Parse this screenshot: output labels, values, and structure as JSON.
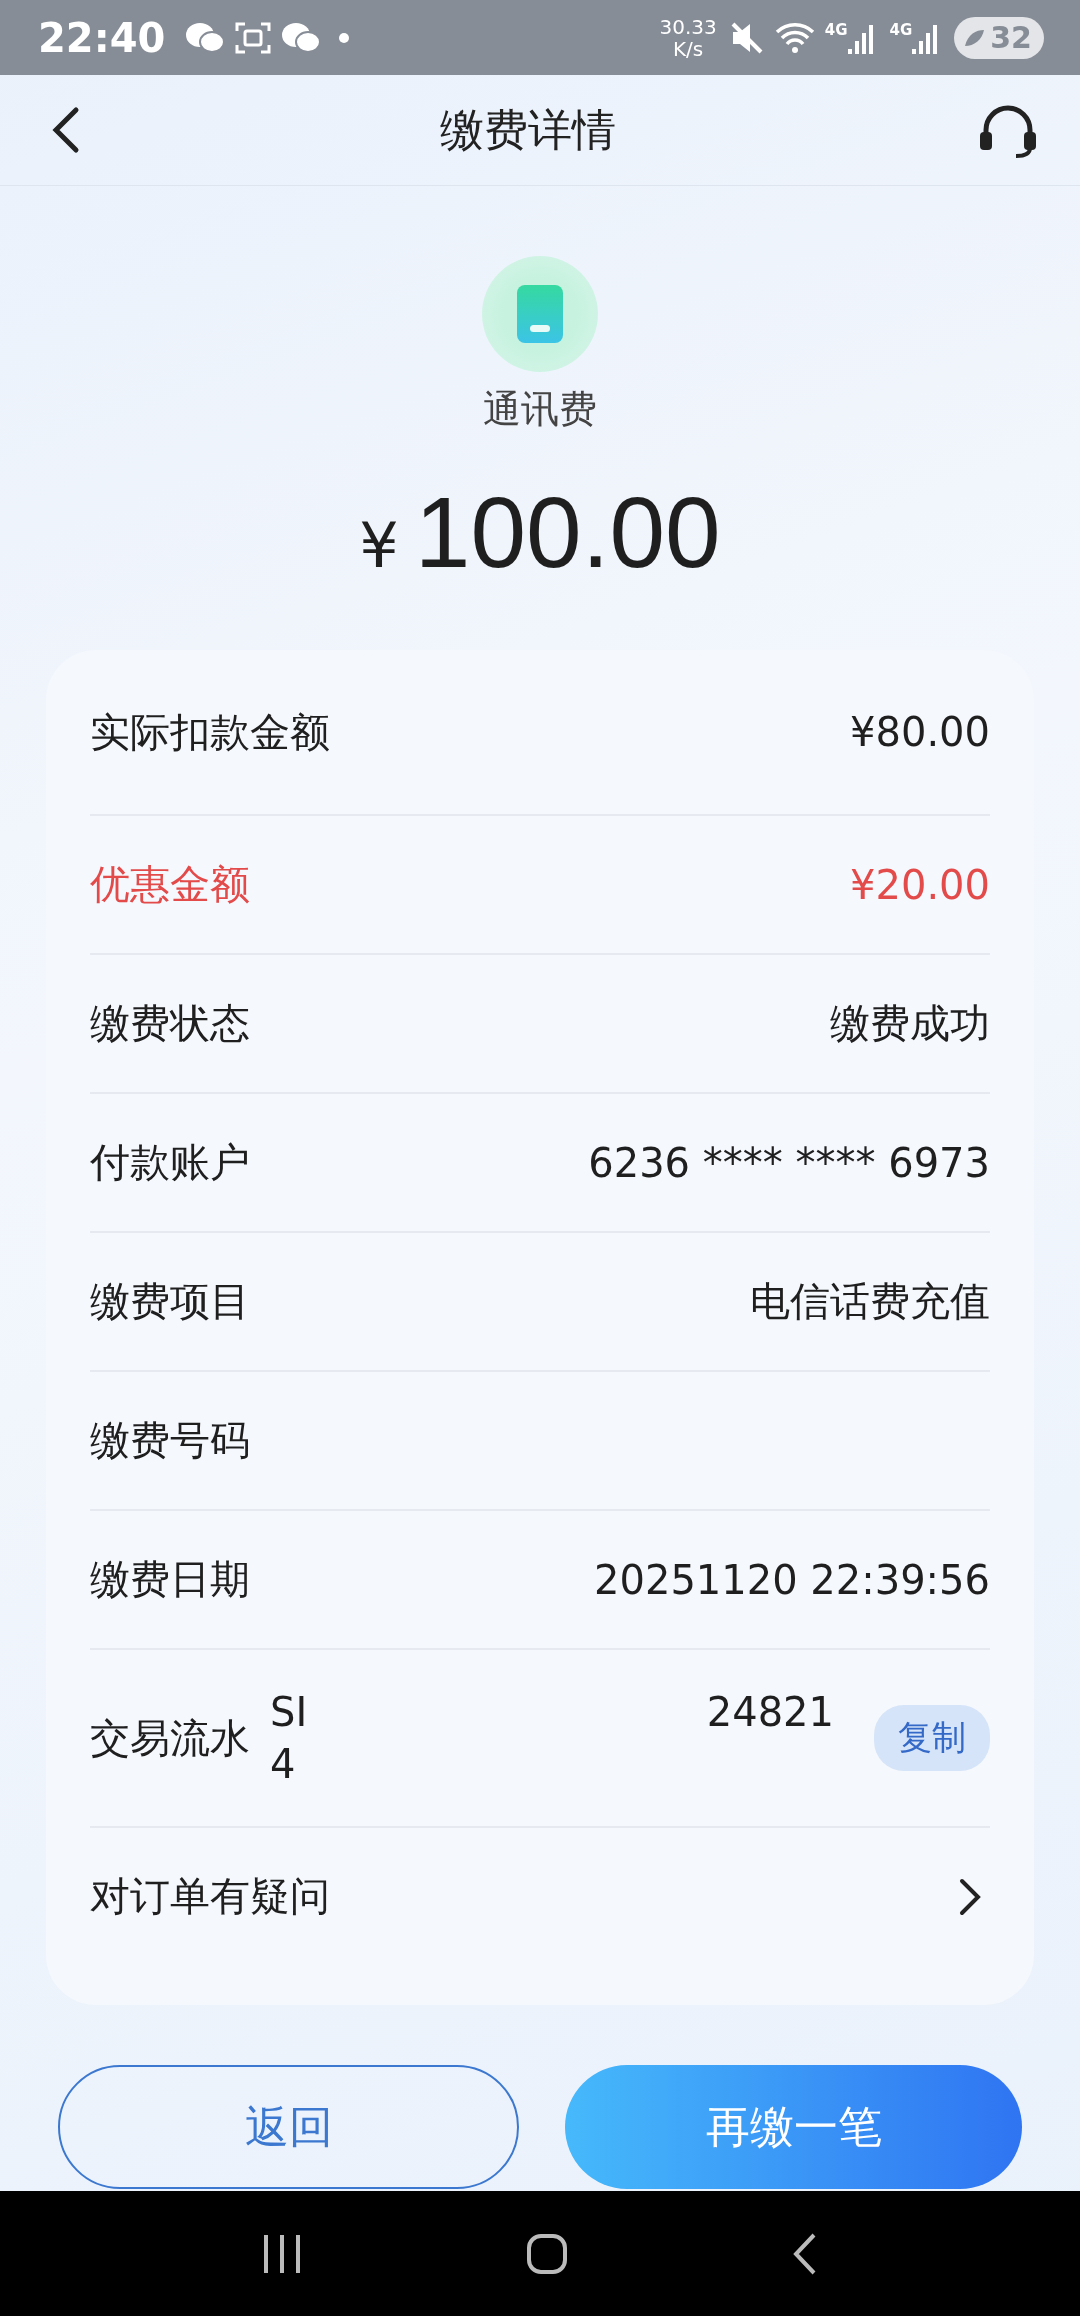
{
  "status_bar": {
    "time": "22:40",
    "speed_value": "30.33",
    "speed_unit": "K/s",
    "networks": [
      "4G",
      "4G"
    ],
    "battery": "32"
  },
  "header": {
    "title": "缴费详情"
  },
  "summary": {
    "category": "通讯费",
    "currency": "¥",
    "amount": "100.00"
  },
  "details": [
    {
      "kind": "plain",
      "label": "实际扣款金额",
      "value": "¥80.00",
      "highlight": false
    },
    {
      "kind": "plain",
      "label": "优惠金额",
      "value": "¥20.00",
      "highlight": true
    },
    {
      "kind": "plain",
      "label": "缴费状态",
      "value": "缴费成功",
      "highlight": false
    },
    {
      "kind": "plain",
      "label": "付款账户",
      "value": "6236 **** **** 6973",
      "highlight": false
    },
    {
      "kind": "plain",
      "label": "缴费项目",
      "value": "电信话费充值",
      "highlight": false
    },
    {
      "kind": "plain",
      "label": "缴费号码",
      "highlight": false
    },
    {
      "kind": "plain",
      "label": "缴费日期",
      "value": "20251120 22:39:56",
      "highlight": false
    },
    {
      "kind": "serial",
      "label": "交易流水",
      "serial_lines": [
        [
          "SI",
          "24821"
        ],
        [
          "4"
        ]
      ],
      "copy_button": "复制",
      "highlight": false
    },
    {
      "kind": "link",
      "label": "对订单有疑问",
      "highlight": false
    }
  ],
  "buttons": [
    {
      "label": "返回",
      "kind": "outline"
    },
    {
      "label": "再缴一笔",
      "kind": "primary"
    }
  ]
}
